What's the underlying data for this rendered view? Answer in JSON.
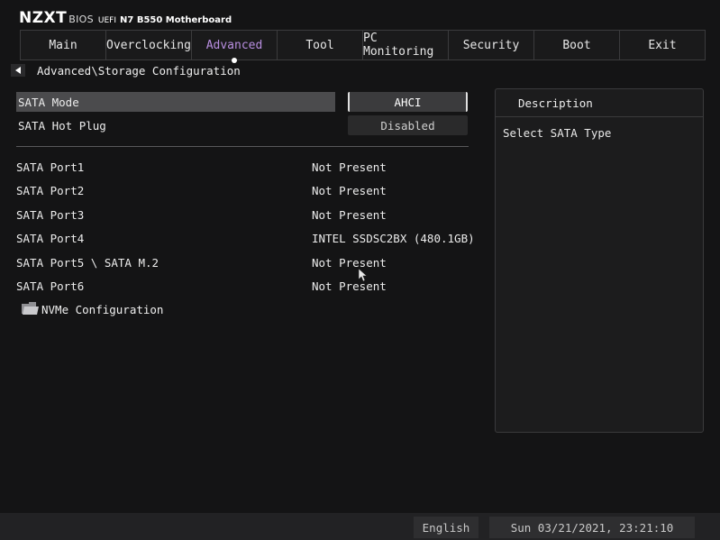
{
  "brand": {
    "logo": "NZXT",
    "bios": "BIOS",
    "uefi": "UEFI",
    "model": "N7 B550 Motherboard"
  },
  "tabs": [
    {
      "label": "Main"
    },
    {
      "label": "Overclocking"
    },
    {
      "label": "Advanced",
      "active": true
    },
    {
      "label": "Tool"
    },
    {
      "label": "PC Monitoring"
    },
    {
      "label": "Security"
    },
    {
      "label": "Boot"
    },
    {
      "label": "Exit"
    }
  ],
  "breadcrumb": "Advanced\\Storage Configuration",
  "settings": {
    "sata_mode": {
      "label": "SATA Mode",
      "value": "AHCI"
    },
    "sata_hot_plug": {
      "label": "SATA Hot Plug",
      "value": "Disabled"
    }
  },
  "ports": [
    {
      "label": "SATA Port1",
      "value": "Not Present"
    },
    {
      "label": "SATA Port2",
      "value": "Not Present"
    },
    {
      "label": "SATA Port3",
      "value": "Not Present"
    },
    {
      "label": "SATA Port4",
      "value": "INTEL SSDSC2BX (480.1GB)"
    },
    {
      "label": "SATA Port5 \\ SATA M.2",
      "value": "Not Present"
    },
    {
      "label": "SATA Port6",
      "value": "Not Present"
    }
  ],
  "submenu": {
    "label": "NVMe Configuration",
    "icon": "folder-icon"
  },
  "description": {
    "title": "Description",
    "text": "Select SATA Type"
  },
  "status": {
    "language": "English",
    "datetime": "Sun 03/21/2021, 23:21:10"
  },
  "colors": {
    "accent": "#b88ee0",
    "background": "#141415",
    "selected_row": "#4b4b4d"
  }
}
